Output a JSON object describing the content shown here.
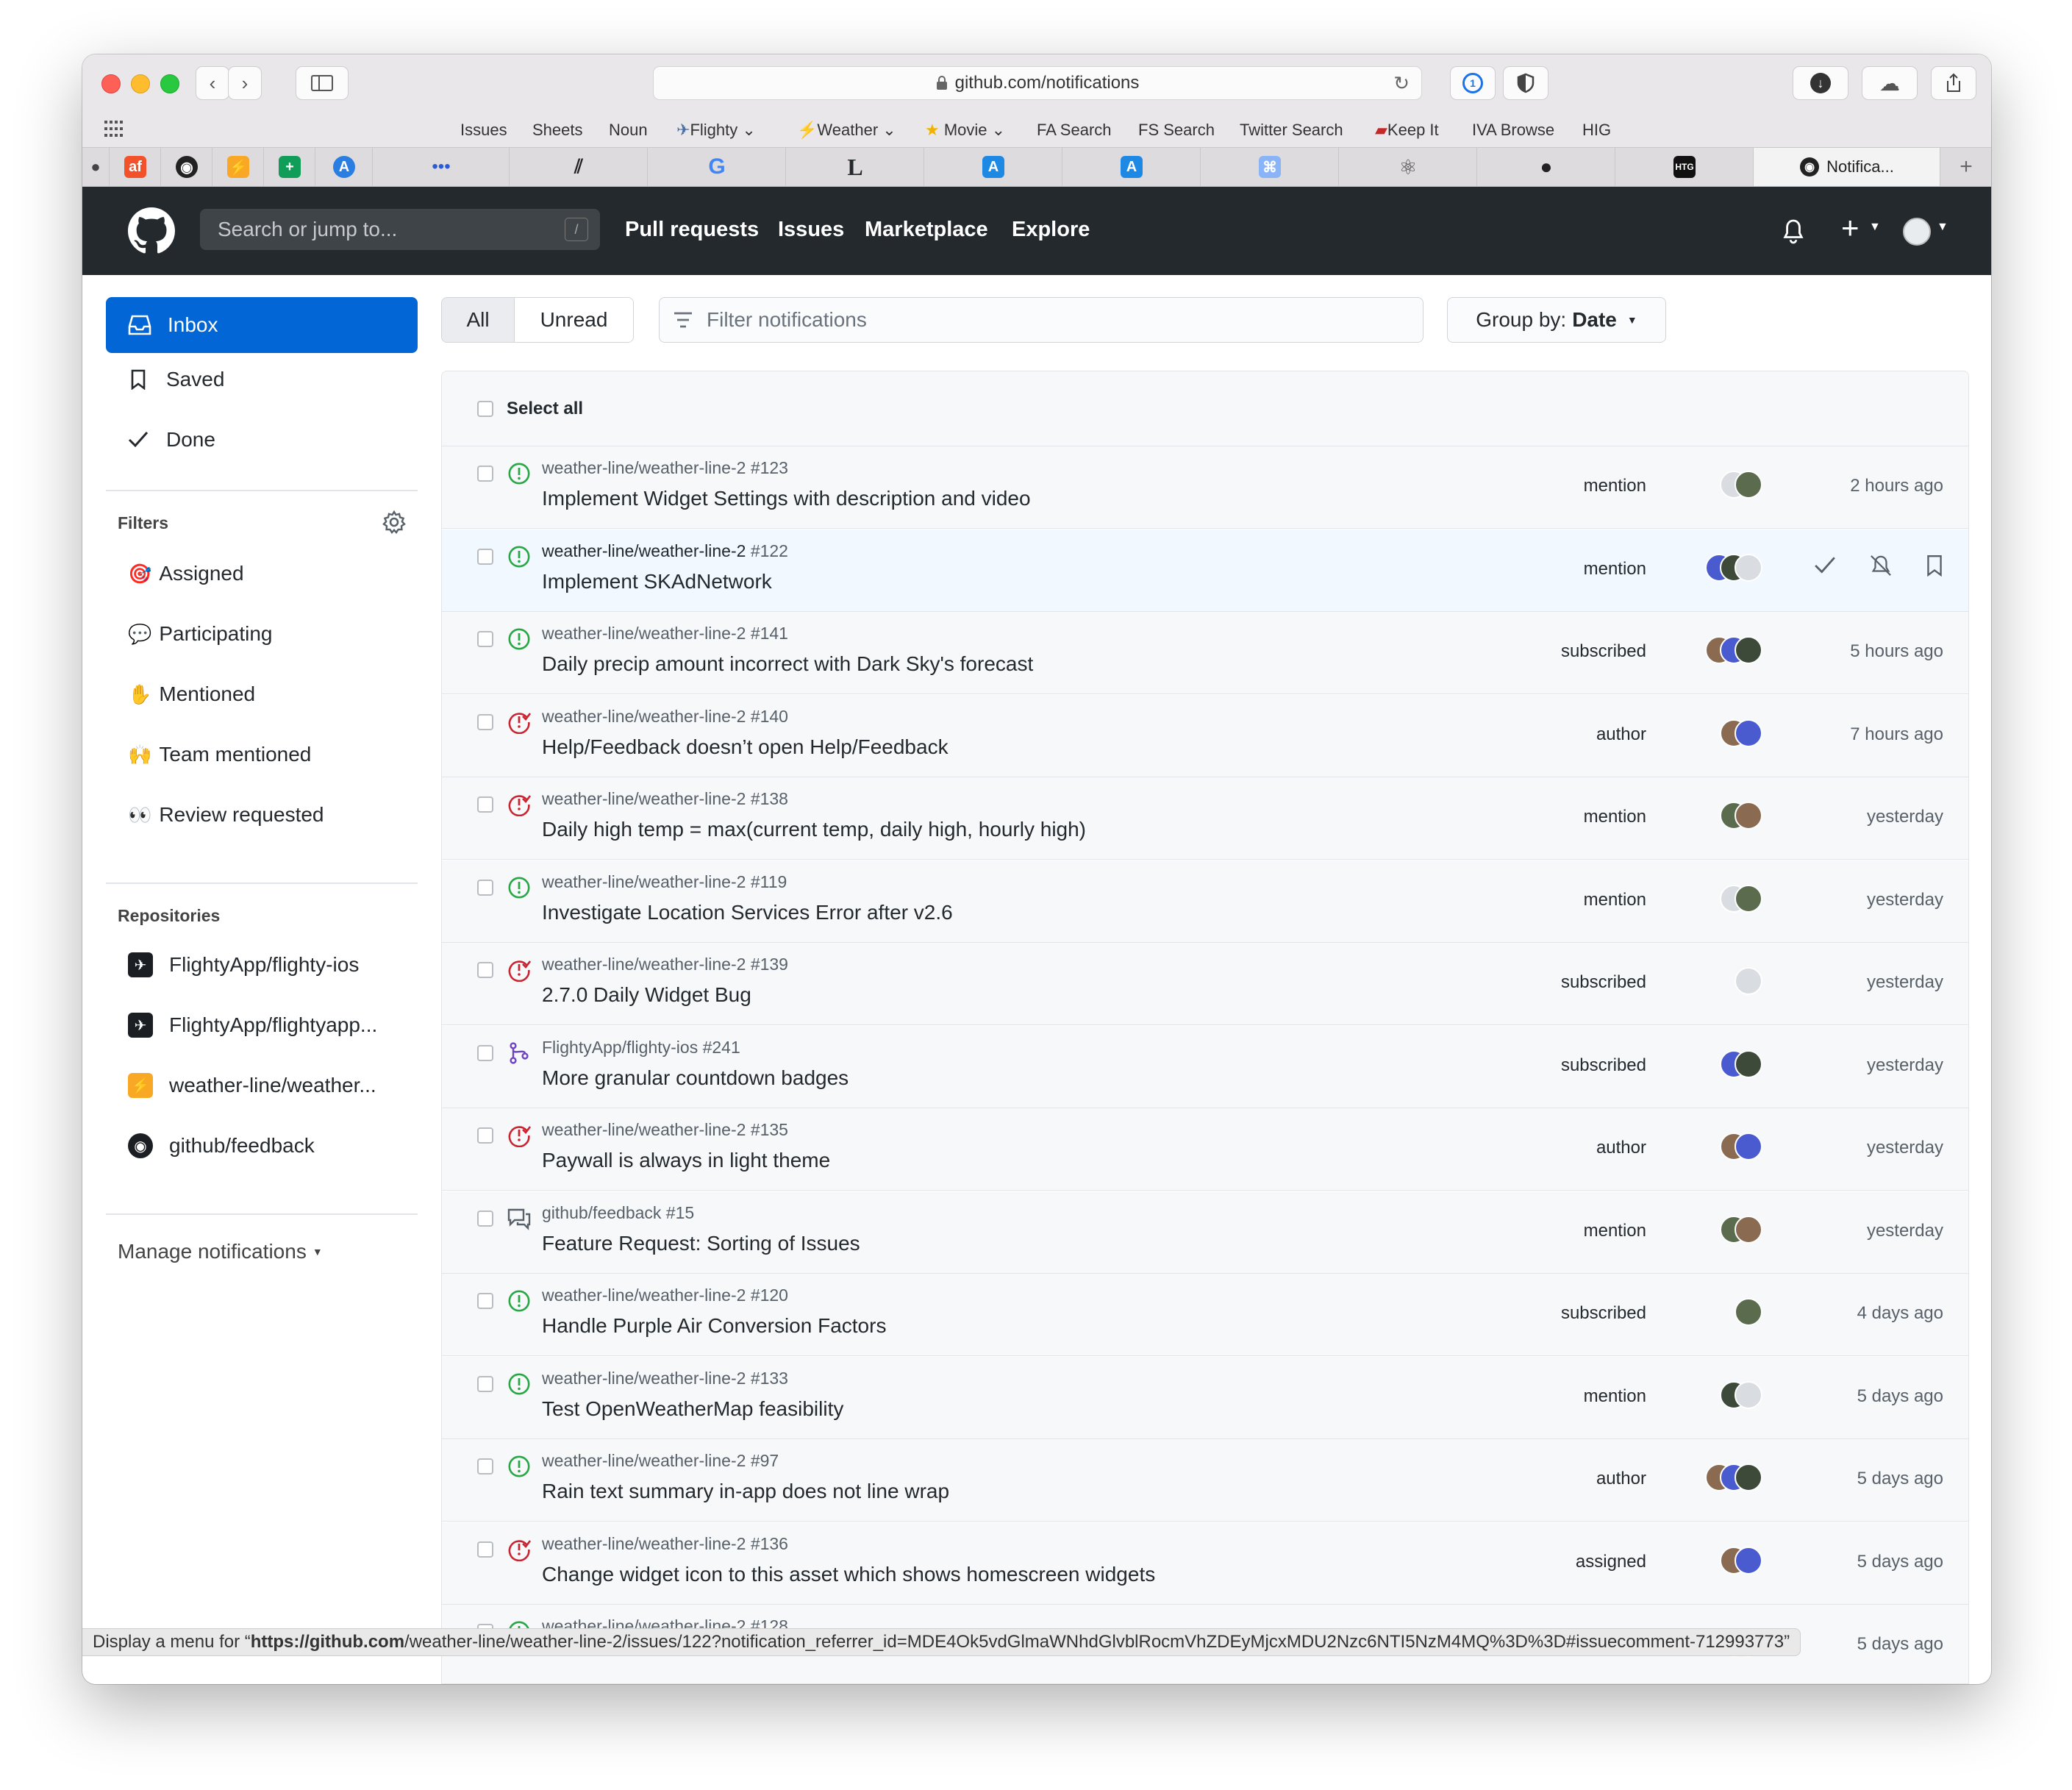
{
  "browser": {
    "url": "github.com/notifications",
    "bookmarks": [
      "Issues",
      "Sheets",
      "Noun",
      "Flighty",
      "Weather",
      "Movie",
      "FA Search",
      "FS Search",
      "Twitter Search",
      "Keep It",
      "IVA Browse",
      "HIG"
    ],
    "active_tab": "Notifica...",
    "status_url_prefix": "Display a menu for “",
    "status_url_host": "https://github.com",
    "status_url_rest": "/weather-line/weather-line-2/issues/122?notification_referrer_id=MDE4Ok5vdGlmaWNhdGlvblRocmVhZDEyMjcxMDU2Nzc6NTI5NzM4MQ%3D%3D#issuecomment-712993773”"
  },
  "header": {
    "search_placeholder": "Search or jump to...",
    "search_shortcut": "/",
    "nav": [
      "Pull requests",
      "Issues",
      "Marketplace",
      "Explore"
    ]
  },
  "sidebar": {
    "main": [
      "Inbox",
      "Saved",
      "Done"
    ],
    "filters_heading": "Filters",
    "filters": [
      {
        "emoji": "🎯",
        "label": "Assigned"
      },
      {
        "emoji": "💬",
        "label": "Participating"
      },
      {
        "emoji": "✋",
        "label": "Mentioned"
      },
      {
        "emoji": "🙌",
        "label": "Team mentioned"
      },
      {
        "emoji": "👀",
        "label": "Review requested"
      }
    ],
    "repos_heading": "Repositories",
    "repos": [
      {
        "label": "FlightyApp/flighty-ios",
        "color": "#1b1f23",
        "glyph": "✈"
      },
      {
        "label": "FlightyApp/flightyapp...",
        "color": "#1b1f23",
        "glyph": "✈"
      },
      {
        "label": "weather-line/weather...",
        "color": "#f9a825",
        "glyph": "⚡"
      },
      {
        "label": "github/feedback",
        "color": "#1b1f23",
        "glyph": "◉"
      }
    ],
    "manage": "Manage notifications"
  },
  "controls": {
    "all": "All",
    "unread": "Unread",
    "filter_placeholder": "Filter notifications",
    "group_by_label": "Group by:",
    "group_by_value": "Date",
    "select_all": "Select all"
  },
  "colors": {
    "open": "#28a745",
    "closed": "#cb2431",
    "pr": "#6f42c1",
    "discussion": "#586069",
    "accent": "#0366d6"
  },
  "notifications": [
    {
      "repo": "weather-line/weather-line-2",
      "num": "#123",
      "title": "Implement Widget Settings with description and video",
      "reason": "mention",
      "time": "2 hours ago",
      "type": "issue-open",
      "avatars": 2
    },
    {
      "repo": "weather-line/weather-line-2",
      "num": "#122",
      "title": "Implement SKAdNetwork",
      "reason": "mention",
      "time": "",
      "type": "issue-open",
      "avatars": 3,
      "hover": true
    },
    {
      "repo": "weather-line/weather-line-2",
      "num": "#141",
      "title": "Daily precip amount incorrect with Dark Sky's forecast",
      "reason": "subscribed",
      "time": "5 hours ago",
      "type": "issue-open",
      "avatars": 3
    },
    {
      "repo": "weather-line/weather-line-2",
      "num": "#140",
      "title": "Help/Feedback doesn’t open Help/Feedback",
      "reason": "author",
      "time": "7 hours ago",
      "type": "issue-closed",
      "avatars": 2
    },
    {
      "repo": "weather-line/weather-line-2",
      "num": "#138",
      "title": "Daily high temp = max(current temp, daily high, hourly high)",
      "reason": "mention",
      "time": "yesterday",
      "type": "issue-closed",
      "avatars": 2
    },
    {
      "repo": "weather-line/weather-line-2",
      "num": "#119",
      "title": "Investigate Location Services Error after v2.6",
      "reason": "mention",
      "time": "yesterday",
      "type": "issue-open",
      "avatars": 2
    },
    {
      "repo": "weather-line/weather-line-2",
      "num": "#139",
      "title": "2.7.0 Daily Widget Bug",
      "reason": "subscribed",
      "time": "yesterday",
      "type": "issue-closed",
      "avatars": 1
    },
    {
      "repo": "FlightyApp/flighty-ios",
      "num": "#241",
      "title": "More granular countdown badges",
      "reason": "subscribed",
      "time": "yesterday",
      "type": "pr",
      "avatars": 2
    },
    {
      "repo": "weather-line/weather-line-2",
      "num": "#135",
      "title": "Paywall is always in light theme",
      "reason": "author",
      "time": "yesterday",
      "type": "issue-closed",
      "avatars": 2
    },
    {
      "repo": "github/feedback",
      "num": "#15",
      "title": "Feature Request: Sorting of Issues",
      "reason": "mention",
      "time": "yesterday",
      "type": "discussion",
      "avatars": 2
    },
    {
      "repo": "weather-line/weather-line-2",
      "num": "#120",
      "title": "Handle Purple Air Conversion Factors",
      "reason": "subscribed",
      "time": "4 days ago",
      "type": "issue-open",
      "avatars": 1
    },
    {
      "repo": "weather-line/weather-line-2",
      "num": "#133",
      "title": "Test OpenWeatherMap feasibility",
      "reason": "mention",
      "time": "5 days ago",
      "type": "issue-open",
      "avatars": 2
    },
    {
      "repo": "weather-line/weather-line-2",
      "num": "#97",
      "title": "Rain text summary in-app does not line wrap",
      "reason": "author",
      "time": "5 days ago",
      "type": "issue-open",
      "avatars": 3
    },
    {
      "repo": "weather-line/weather-line-2",
      "num": "#136",
      "title": "Change widget icon to this asset which shows homescreen widgets",
      "reason": "assigned",
      "time": "5 days ago",
      "type": "issue-closed",
      "avatars": 2
    },
    {
      "repo": "weather-line/weather-line-2",
      "num": "#128",
      "title": "",
      "reason": "mention",
      "time": "5 days ago",
      "type": "issue-open",
      "avatars": 2
    }
  ]
}
